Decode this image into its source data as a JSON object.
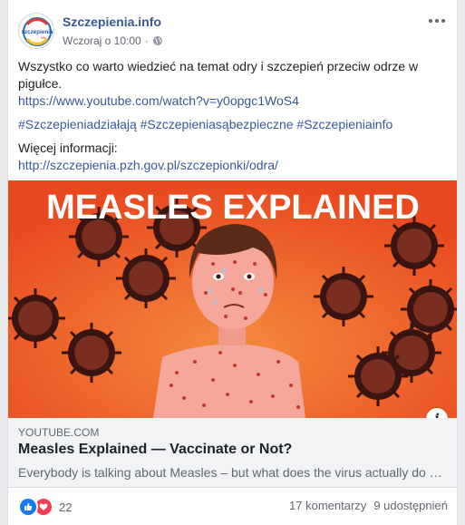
{
  "post": {
    "page_name": "Szczepienia.info",
    "timestamp": "Wczoraj o 10:00",
    "separator": "·",
    "avatar_logo_text": "szczepienia",
    "avatar_logo_subtext": "info",
    "text_line1": "Wszystko co warto wiedzieć na temat odry i szczepień przeciw odrze w pigułce.",
    "youtube_url": "https://www.youtube.com/watch?v=y0opgc1WoS4",
    "hashtags": "#Szczepieniadziałają #Szczepieniasąbezpieczne #Szczepieniainfo",
    "more_info_label": "Więcej informacji:",
    "more_info_url": "http://szczepienia.pzh.gov.pl/szczepionki/odra/"
  },
  "link_preview": {
    "image_headline": "MEASLES EXPLAINED",
    "domain": "YOUTUBE.COM",
    "title": "Measles Explained — Vaccinate or Not?",
    "description": "Everybody is talking about Measles – but what does the virus actually do …",
    "info_icon_glyph": "i"
  },
  "footer": {
    "reaction_count": "22",
    "comments": "17 komentarzy",
    "shares": "9 udostępnień"
  },
  "icons": {
    "more": "more-horizontal-icon",
    "privacy": "globe-icon",
    "like": "like-reaction-icon",
    "love": "love-reaction-icon",
    "info": "info-icon"
  },
  "colors": {
    "link_blue": "#385898",
    "image_orange": "#ef5a2a",
    "like_blue": "#1877f2",
    "love_red": "#f33e58"
  }
}
